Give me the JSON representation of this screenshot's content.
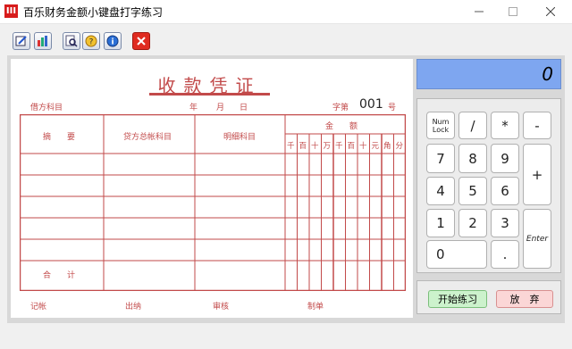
{
  "window": {
    "title": "百乐财务金额小键盘打字练习",
    "icon_label": "III"
  },
  "toolbar": {
    "buttons": [
      "edit-icon",
      "chart-icon",
      "preview-icon",
      "help-icon",
      "info-icon",
      "close-red-icon"
    ]
  },
  "voucher": {
    "title": "收款凭证",
    "debit_account_label": "借方科目",
    "date": {
      "year": "年",
      "month": "月",
      "day": "日"
    },
    "number_label": "字第",
    "number_value": "001",
    "number_suffix": "号",
    "headers": {
      "summary": "摘　　要",
      "credit_account": "贷方总帐科目",
      "detail_account": "明细科目",
      "amount": "金　　额",
      "digits": [
        "千",
        "百",
        "十",
        "万",
        "千",
        "百",
        "十",
        "元",
        "角",
        "分"
      ]
    },
    "total_label": "合　　计",
    "footer": {
      "bookkeeper": "记帐",
      "cashier": "出纳",
      "reviewer": "审核",
      "preparer": "制单"
    },
    "colors": {
      "ink": "#c24a4a"
    }
  },
  "keypad": {
    "display_value": "0",
    "keys": {
      "numlock_line1": "Num",
      "numlock_line2": "Lock",
      "divide": "/",
      "multiply": "*",
      "minus": "-",
      "k7": "7",
      "k8": "8",
      "k9": "9",
      "plus": "+",
      "k4": "4",
      "k5": "5",
      "k6": "6",
      "k1": "1",
      "k2": "2",
      "k3": "3",
      "enter": "Enter",
      "k0": "0",
      "dot": "."
    }
  },
  "actions": {
    "start_label": "开始练习",
    "abandon_label": "放　弃"
  }
}
